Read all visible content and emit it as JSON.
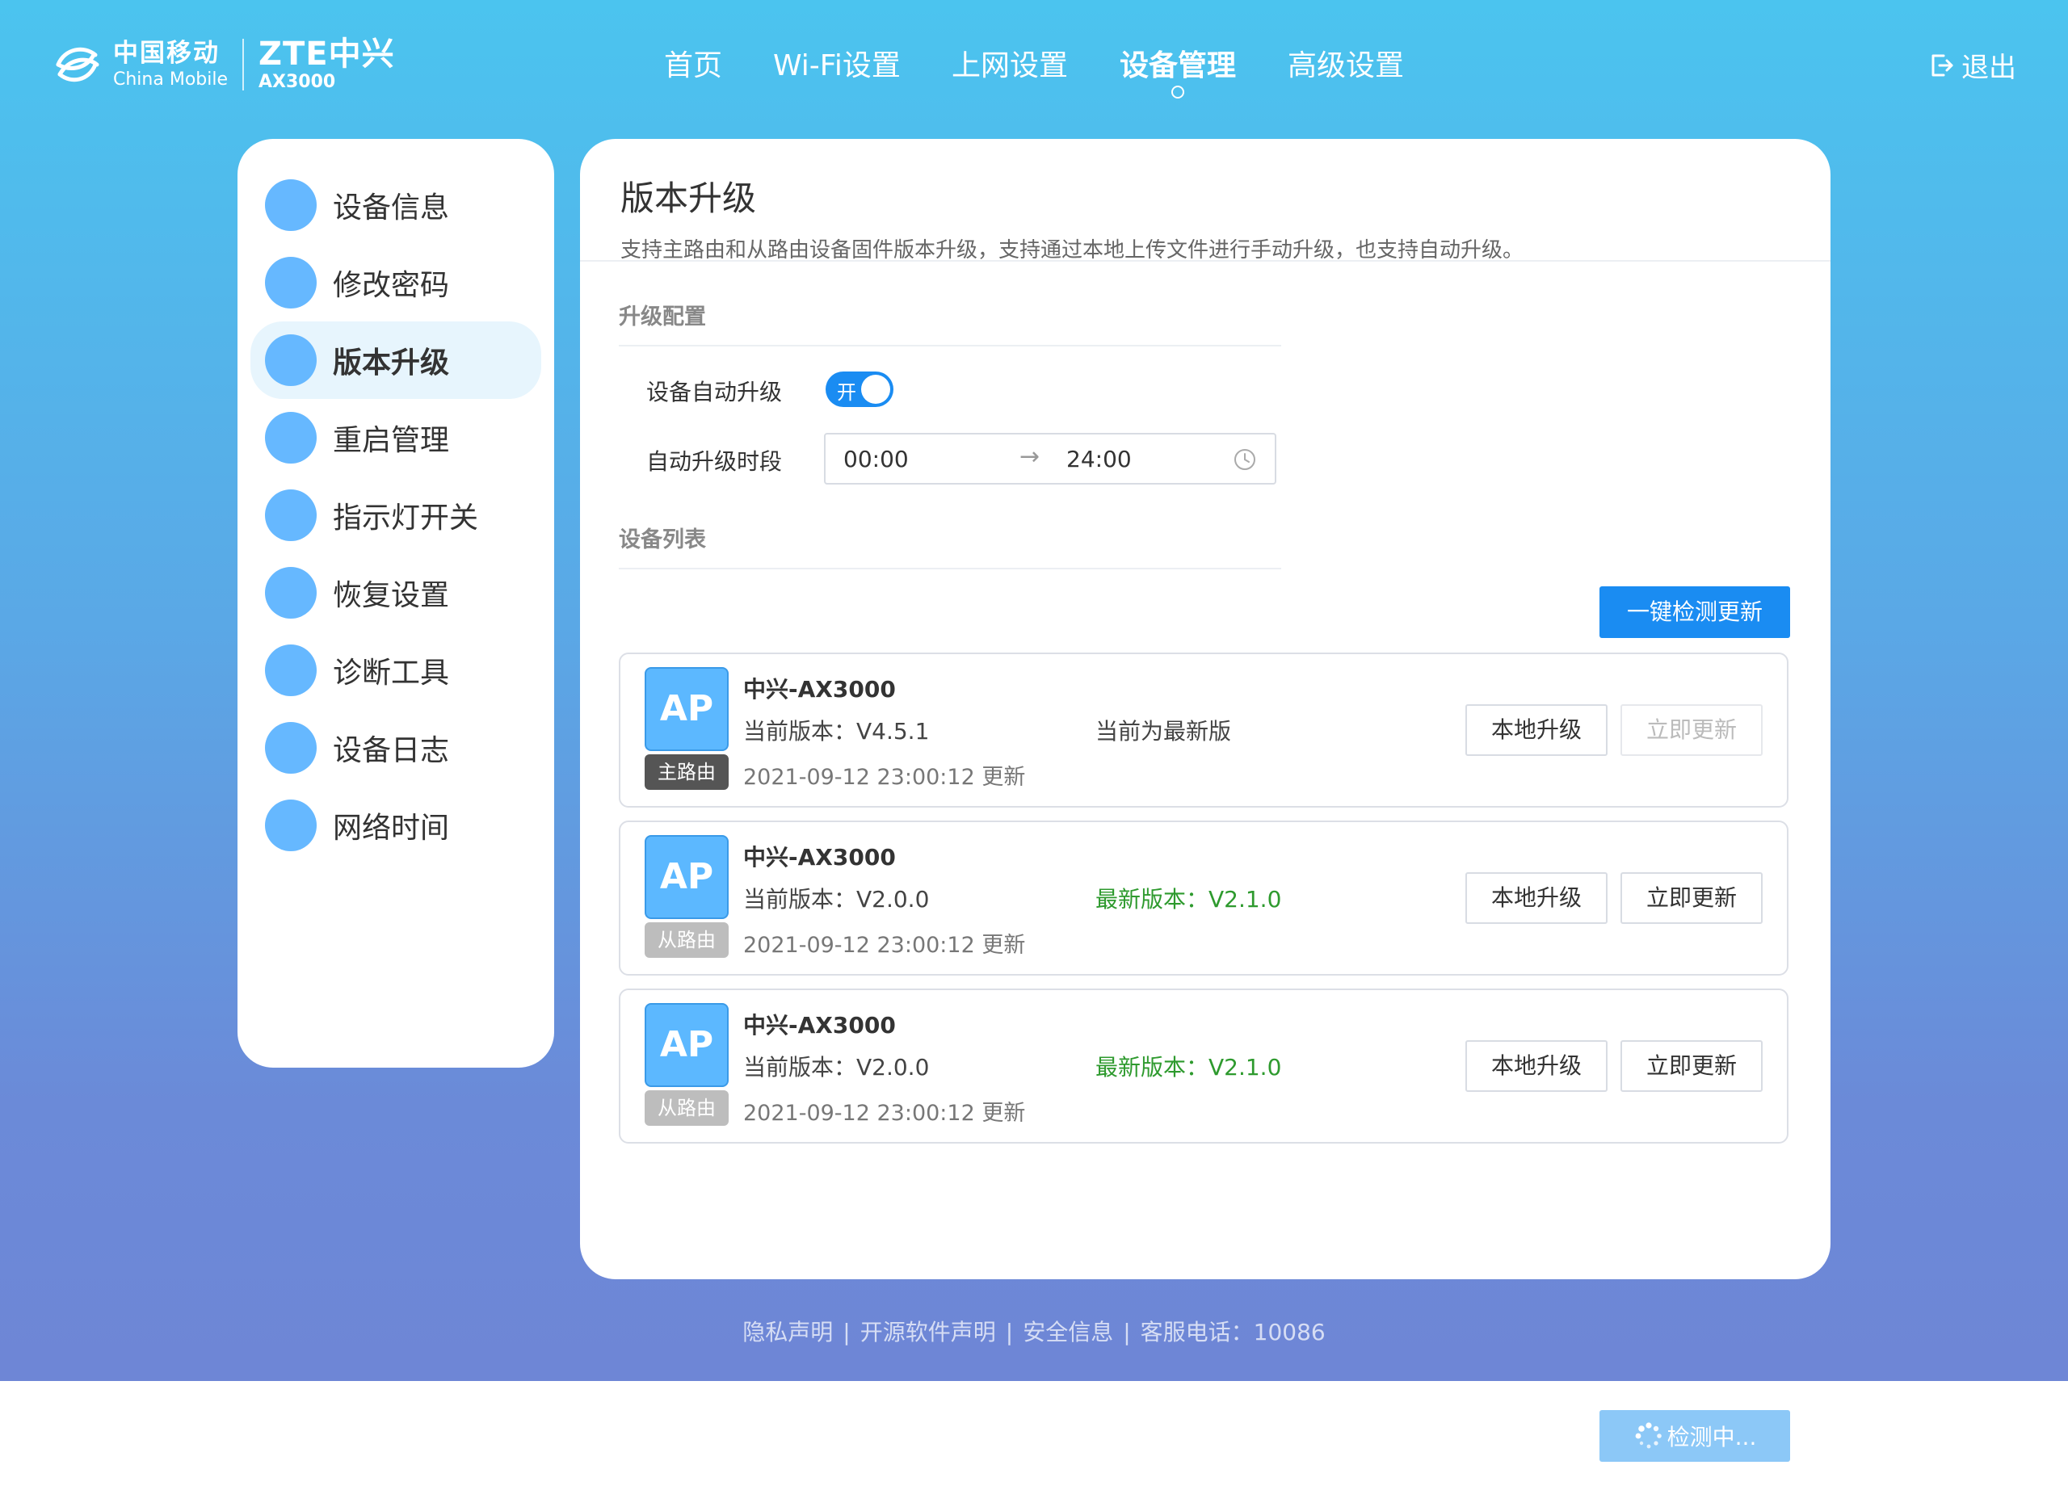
{
  "brand": {
    "cm_cn": "中国移动",
    "cm_en": "China Mobile",
    "zte_name": "ZTE中兴",
    "zte_model": "AX3000"
  },
  "nav": {
    "items": [
      {
        "label": "首页",
        "active": false
      },
      {
        "label": "Wi-Fi设置",
        "active": false
      },
      {
        "label": "上网设置",
        "active": false
      },
      {
        "label": "设备管理",
        "active": true
      },
      {
        "label": "高级设置",
        "active": false
      }
    ],
    "logout": "退出"
  },
  "sidebar": {
    "items": [
      {
        "label": "设备信息",
        "active": false
      },
      {
        "label": "修改密码",
        "active": false
      },
      {
        "label": "版本升级",
        "active": true
      },
      {
        "label": "重启管理",
        "active": false
      },
      {
        "label": "指示灯开关",
        "active": false
      },
      {
        "label": "恢复设置",
        "active": false
      },
      {
        "label": "诊断工具",
        "active": false
      },
      {
        "label": "设备日志",
        "active": false
      },
      {
        "label": "网络时间",
        "active": false
      }
    ]
  },
  "main": {
    "title": "版本升级",
    "description": "支持主路由和从路由设备固件版本升级，支持通过本地上传文件进行手动升级，也支持自动升级。",
    "config_section": "升级配置",
    "auto_upgrade_label": "设备自动升级",
    "auto_upgrade_switch": "开",
    "auto_upgrade_on": true,
    "period_label": "自动升级时段",
    "period_start": "00:00",
    "period_arrow": "→",
    "period_end": "24:00",
    "device_section": "设备列表",
    "check_all_button": "一键检测更新"
  },
  "devices": [
    {
      "icon": "AP",
      "role": "主路由",
      "name": "中兴-AX3000",
      "current_version": "当前版本：V4.5.1",
      "status": "当前为最新版",
      "status_type": "latest",
      "time": "2021-09-12 23:00:12 更新",
      "local_button": "本地升级",
      "update_button": "立即更新",
      "update_disabled": true
    },
    {
      "icon": "AP",
      "role": "从路由",
      "name": "中兴-AX3000",
      "current_version": "当前版本：V2.0.0",
      "status": "最新版本：V2.1.0",
      "status_type": "new",
      "time": "2021-09-12 23:00:12 更新",
      "local_button": "本地升级",
      "update_button": "立即更新",
      "update_disabled": false
    },
    {
      "icon": "AP",
      "role": "从路由",
      "name": "中兴-AX3000",
      "current_version": "当前版本：V2.0.0",
      "status": "最新版本：V2.1.0",
      "status_type": "new",
      "time": "2021-09-12 23:00:12 更新",
      "local_button": "本地升级",
      "update_button": "立即更新",
      "update_disabled": false
    }
  ],
  "footer": {
    "links": [
      "隐私声明",
      "开源软件声明",
      "安全信息"
    ],
    "separator": "|",
    "hotline": "客服电话：10086"
  },
  "checking": {
    "label": "检测中..."
  },
  "colors": {
    "primary": "#1a8cf2",
    "sidebar_dot": "#66b8ff",
    "new_version": "#2e9a2e",
    "main_tag": "#555555",
    "sub_tag": "#bdbdbd"
  }
}
